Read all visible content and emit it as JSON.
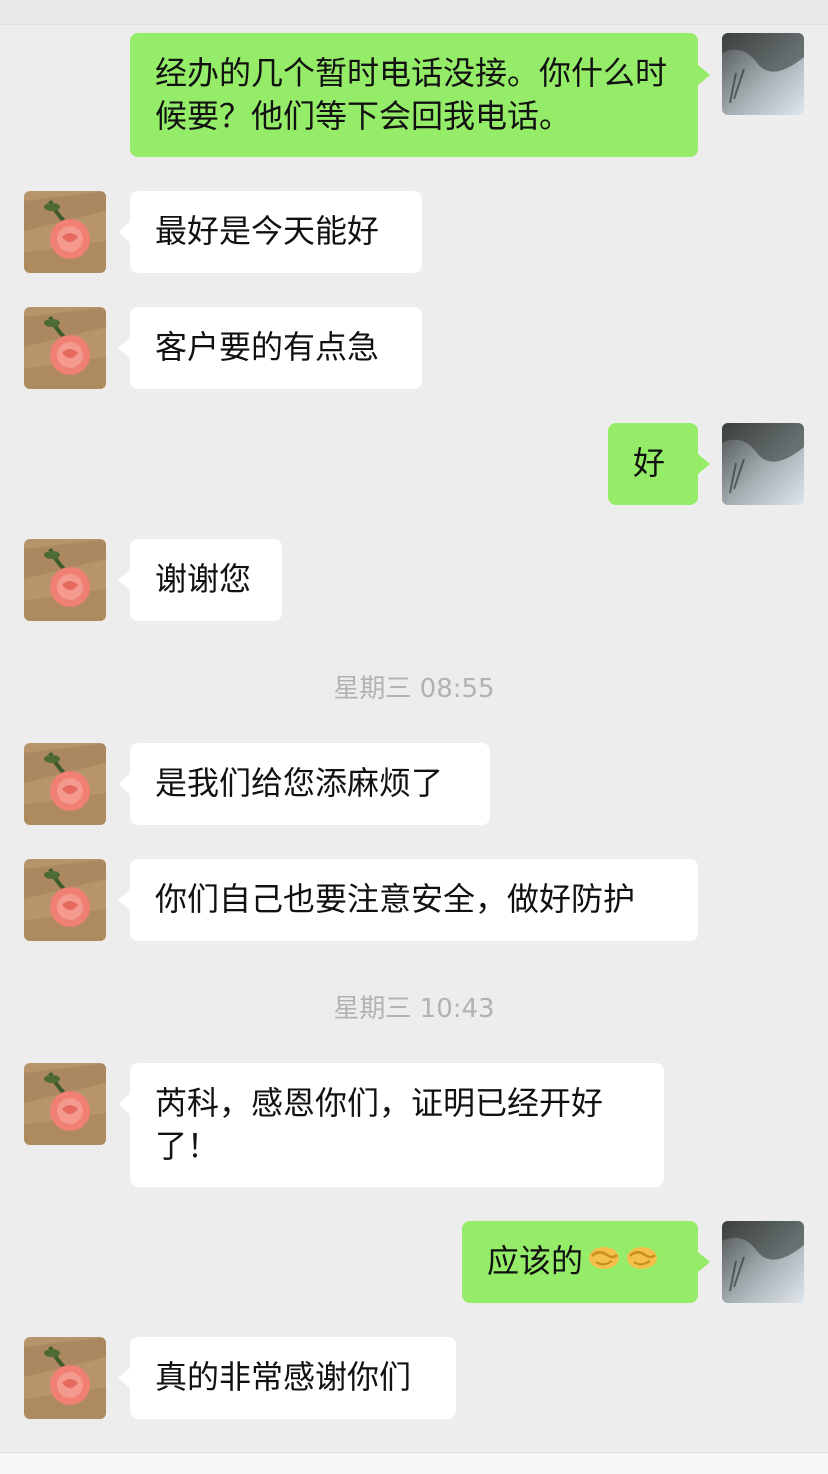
{
  "messages": [
    {
      "side": "out",
      "text": "经办的几个暂时电话没接。你什么时候要？他们等下会回我电话。"
    },
    {
      "side": "in",
      "text": "最好是今天能好"
    },
    {
      "side": "in",
      "text": "客户要的有点急"
    },
    {
      "side": "out",
      "text": "好"
    },
    {
      "side": "in",
      "text": "谢谢您"
    },
    {
      "side": "in",
      "text": "是我们给您添麻烦了"
    },
    {
      "side": "in",
      "text": "你们自己也要注意安全，做好防护"
    },
    {
      "side": "in",
      "text": "芮科，感恩你们，证明已经开好了！"
    },
    {
      "side": "out",
      "text": "应该的",
      "emoji": "handshake-icon"
    },
    {
      "side": "in",
      "text": "真的非常感谢你们"
    }
  ],
  "timestamps": [
    "星期三 08:55",
    "星期三 10:43"
  ],
  "colors": {
    "background": "#ededed",
    "sent_bubble": "#95ec69",
    "received_bubble": "#ffffff",
    "timestamp": "#b2b2b2"
  },
  "avatars": {
    "self": "ink-landscape-avatar",
    "contact": "rose-avatar"
  }
}
